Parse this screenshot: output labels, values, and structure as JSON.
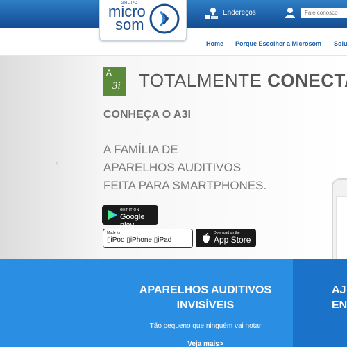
{
  "header": {
    "logo": {
      "grupo": "GRUPO",
      "micro": "micro",
      "som": "som"
    },
    "enderecos": "Endereços",
    "contact_placeholder": "Fale conosco"
  },
  "nav": {
    "items": [
      "Home",
      "Porque Escolher a Microsom",
      "Solu"
    ]
  },
  "hero": {
    "badge_line1": "A",
    "badge_line2": "3i",
    "title_light": "TOTALMENTE ",
    "title_bold": "CONECTA",
    "subtitle": "CONHEÇA O A3I",
    "body_lines": [
      "A FAMÍLIA DE",
      "APARELHOS AUDITIVOS",
      "FEITA PARA SMARTPHONES."
    ],
    "google_play": {
      "small": "GET IT ON",
      "big": "Google play"
    },
    "ipod_badge": {
      "made_for": "Made for",
      "items": [
        "iPod",
        "iPhone",
        "iPad"
      ]
    },
    "app_store": {
      "small": "Download on the",
      "big": "App Store"
    }
  },
  "cards": [
    {
      "title_line1": "APARELHOS AUDITIVOS",
      "title_line2": "INVISÍVEIS",
      "subtitle": "Tão pequeno que ninguém vai notar",
      "link": "Veja mais>"
    },
    {
      "title_line1": "AJ",
      "title_line2": "EN"
    }
  ],
  "colors": {
    "header_blue": "#1d5fa8",
    "card_blue": "#2a8ee3",
    "card_blue_dark": "#1b73c9",
    "a3i_green": "#5b8b3a"
  }
}
